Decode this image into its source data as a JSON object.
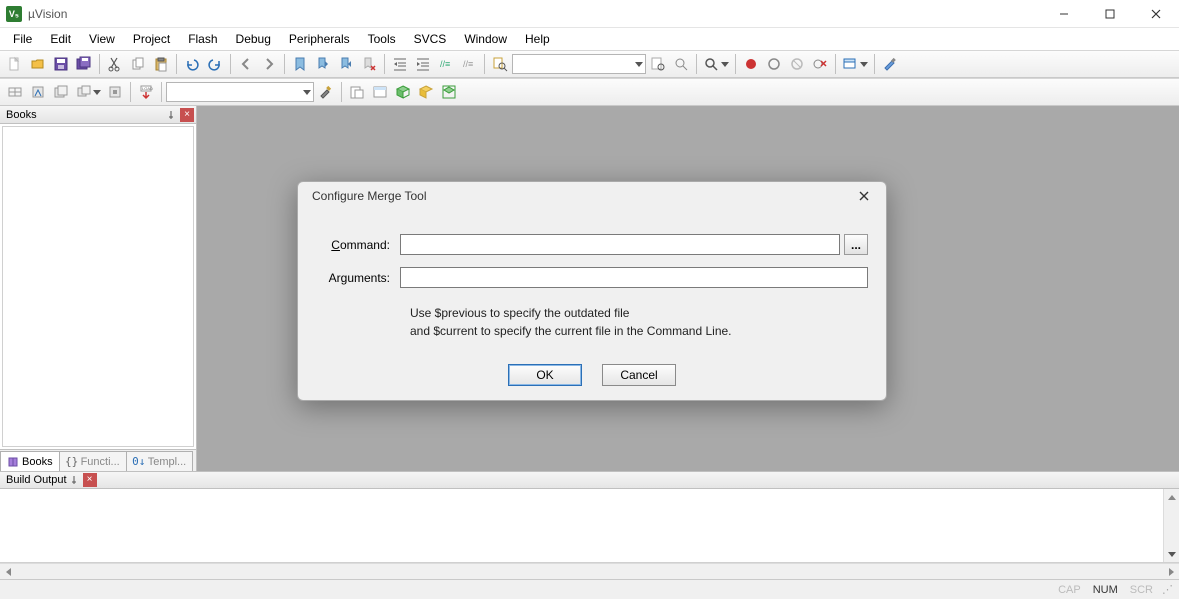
{
  "window": {
    "title": "µVision",
    "app_icon_text": "V₅"
  },
  "menu": [
    "File",
    "Edit",
    "View",
    "Project",
    "Flash",
    "Debug",
    "Peripherals",
    "Tools",
    "SVCS",
    "Window",
    "Help"
  ],
  "toolbar1": {
    "combo_value": ""
  },
  "toolbar2": {
    "target_combo": "",
    "load_label": "LOAD"
  },
  "books_panel": {
    "title": "Books",
    "tabs": [
      {
        "icon": "books-icon",
        "label": "Books",
        "active": true
      },
      {
        "icon": "braces-icon",
        "label": "Functi...",
        "active": false
      },
      {
        "icon": "template-icon",
        "label": "Templ...",
        "active": false
      }
    ]
  },
  "dialog": {
    "title": "Configure Merge Tool",
    "command_label_pre": "",
    "command_label_u": "C",
    "command_label_post": "ommand:",
    "command_value": "",
    "browse_label": "...",
    "arguments_label": "Arguments:",
    "arguments_value": "",
    "hint_line1": "Use $previous to specify the outdated file",
    "hint_line2": "and $current to specify the current file in the Command Line.",
    "ok": "OK",
    "cancel": "Cancel"
  },
  "build_panel": {
    "title": "Build Output"
  },
  "statusbar": {
    "cap": "CAP",
    "num": "NUM",
    "scr": "SCR"
  }
}
